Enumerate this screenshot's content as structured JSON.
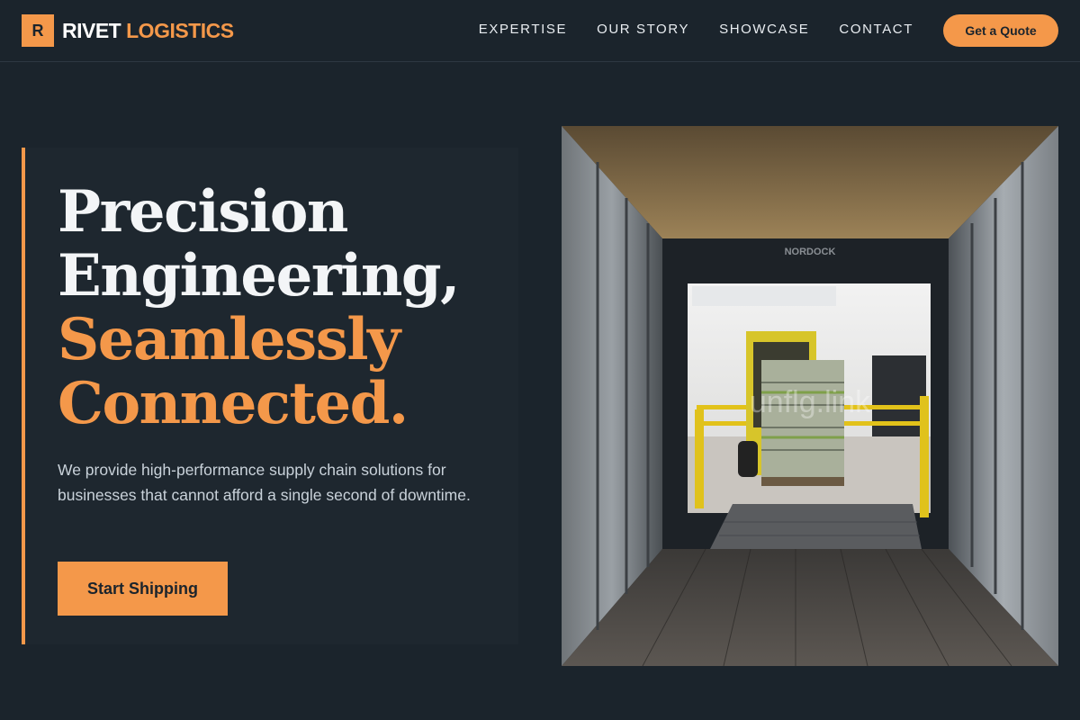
{
  "header": {
    "logo_mark": "R",
    "brand_word1": "RIVET",
    "brand_word2": "LOGISTICS",
    "nav": [
      "EXPERTISE",
      "OUR STORY",
      "SHOWCASE",
      "CONTACT"
    ],
    "quote_button": "Get a Quote"
  },
  "hero": {
    "headline_line1": "Precision",
    "headline_line2": "Engineering,",
    "headline_line3": "Seamlessly",
    "headline_line4": "Connected.",
    "subtext": "We provide high-performance supply chain solutions for businesses that cannot afford a single second of downtime.",
    "cta_label": "Start Shipping",
    "image_watermark": "unflg.link",
    "image_dock_sign": "NORDOCK"
  },
  "colors": {
    "accent": "#f4984a",
    "background": "#1b242c",
    "text_light": "#c9d2da"
  }
}
